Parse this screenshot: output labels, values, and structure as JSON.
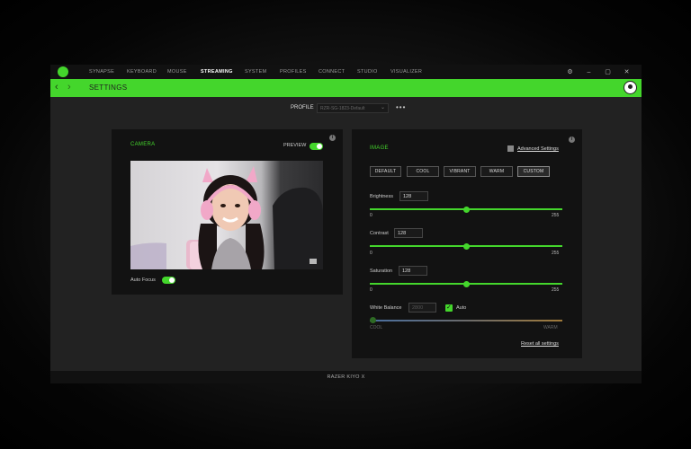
{
  "nav": {
    "items": [
      "SYNAPSE",
      "KEYBOARD",
      "MOUSE",
      "STREAMING",
      "SYSTEM",
      "PROFILES",
      "CONNECT",
      "STUDIO",
      "VISUALIZER"
    ],
    "active": "STREAMING"
  },
  "window_controls": {
    "settings": "⚙",
    "minimize": "–",
    "maximize": "▢",
    "close": "✕"
  },
  "header": {
    "back": "‹",
    "forward": "›",
    "title": "SETTINGS"
  },
  "profile": {
    "label": "PROFILE",
    "value": "RZR-SG-1823-Default",
    "more": "•••"
  },
  "camera": {
    "title": "CAMERA",
    "preview_label": "PREVIEW",
    "preview_on": true,
    "autofocus_label": "Auto Focus",
    "autofocus_on": true
  },
  "image": {
    "title": "IMAGE",
    "advanced": "Advanced Settings",
    "presets": [
      "DEFAULT",
      "COOL",
      "VIBRANT",
      "WARM",
      "CUSTOM"
    ],
    "selected_preset": "CUSTOM",
    "brightness": {
      "label": "Brightness",
      "value": "128",
      "min": "0",
      "max": "255"
    },
    "contrast": {
      "label": "Contrast",
      "value": "128",
      "min": "0",
      "max": "255"
    },
    "saturation": {
      "label": "Saturation",
      "value": "128",
      "min": "0",
      "max": "255"
    },
    "white_balance": {
      "label": "White Balance",
      "value": "2800",
      "auto_label": "Auto",
      "auto_checked": true,
      "min_label": "COOL",
      "max_label": "WARM"
    },
    "reset": "Reset all settings"
  },
  "status": {
    "device": "RAZER KIYO X"
  },
  "colors": {
    "accent": "#44d62c",
    "panel": "#121212",
    "background": "#222222"
  }
}
